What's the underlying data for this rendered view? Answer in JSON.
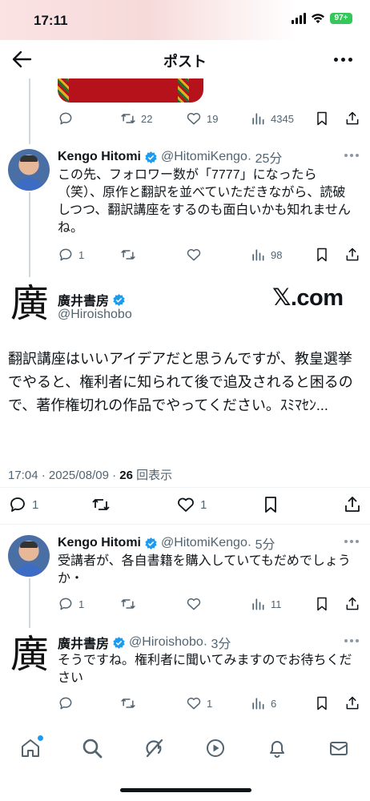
{
  "status_bar": {
    "time": "17:11",
    "battery": "97+"
  },
  "nav": {
    "title": "ポスト"
  },
  "prev_tweet_actions": {
    "replies": "",
    "retweets": "22",
    "likes": "19",
    "views": "4345"
  },
  "reply1": {
    "name": "Kengo Hitomi",
    "handle": "@HitomiKengo",
    "time": "· 25分",
    "text": "この先、フォロワー数が「7777」になったら（笑）、原作と翻訳を並べていただきながら、読破しつつ、翻訳講座をするのも面白いかも知れませんね。",
    "replies": "1",
    "retweets": "",
    "likes": "",
    "views": "98"
  },
  "main": {
    "name": "廣井書房",
    "handle": "@Hiroishobo",
    "avatar_char": "廣",
    "xcom": "𝕏.com",
    "text": "翻訳講座はいいアイデアだと思うんですが、教皇選挙でやると、権利者に知られて後で追及されると困るので、著作権切れの作品でやってください。ｽﾐﾏｾﾝ...",
    "meta_date": "17:04 · 2025/08/09 · ",
    "meta_views": "26",
    "meta_views_label": " 回表示",
    "replies": "1",
    "retweets": "",
    "likes": "1"
  },
  "reply2": {
    "name": "Kengo Hitomi",
    "handle": "@HitomiKengo",
    "time": "· 5分",
    "text": "受講者が、各自書籍を購入していてもだめでしょうか・",
    "replies": "1",
    "retweets": "",
    "likes": "",
    "views": "11"
  },
  "reply3": {
    "name": "廣井書房",
    "handle": "@Hiroishobo",
    "time": "· 3分",
    "avatar_char": "廣",
    "text": "そうですね。権利者に聞いてみますのでお待ちください",
    "replies": "",
    "retweets": "",
    "likes": "1",
    "views": "6"
  },
  "tabbar": {
    "items": [
      "home-icon",
      "search-icon",
      "grok-icon",
      "video-icon",
      "bell-icon",
      "mail-icon"
    ]
  },
  "colors": {
    "verified": "#1d9bf0",
    "muted": "#536471",
    "battery": "#34c759"
  }
}
